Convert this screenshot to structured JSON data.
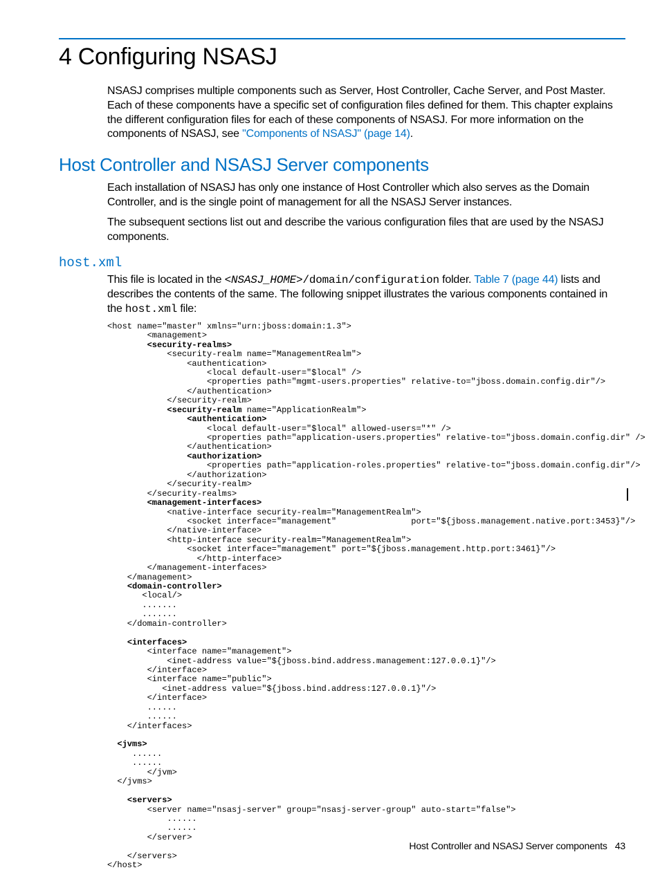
{
  "chapter": {
    "title": "4 Configuring NSASJ"
  },
  "intro": {
    "text_a": "NSASJ comprises multiple components such as Server, Host Controller, Cache Server, and Post Master. Each of these components have a specific set of configuration files defined for them. This chapter explains the different configuration files for each of these components of NSASJ. For more information on the components of NSASJ, see ",
    "link": "\"Components of NSASJ\" (page 14)",
    "text_b": "."
  },
  "section": {
    "title": "Host Controller and NSASJ Server components",
    "p1": "Each installation of NSASJ has only one instance of Host Controller which also serves as the Domain Controller, and is the single point of management for all the NSASJ Server instances.",
    "p2": "The subsequent sections list out and describe the various configuration files that are used by the NSASJ components."
  },
  "file": {
    "heading": "host.xml",
    "desc_pre": "This file is located in the ",
    "desc_path_em": "<NSASJ_HOME>",
    "desc_path_rest": "/domain/configuration",
    "desc_after_path": " folder. ",
    "desc_link": "Table 7 (page 44)",
    "desc_post_link": " lists and describes the contents of the same. The following snippet illustrates the various components contained in the ",
    "desc_filename": "host.xml",
    "desc_end": " file:"
  },
  "code": "<host name=\"master\" xmlns=\"urn:jboss:domain:1.3\">\n        <management>\n        <b><security-realms></b>\n            <security-realm name=\"ManagementRealm\">\n                <authentication>\n                    <local default-user=\"$local\" />\n                    <properties path=\"mgmt-users.properties\" relative-to=\"jboss.domain.config.dir\"/>\n                </authentication>\n            </security-realm>\n            <b><security-realm</b> name=\"ApplicationRealm\">\n                <b><authentication></b>\n                    <local default-user=\"$local\" allowed-users=\"*\" />\n                    <properties path=\"application-users.properties\" relative-to=\"jboss.domain.config.dir\" />\n                </authentication>\n                <b><authorization></b>\n                    <properties path=\"application-roles.properties\" relative-to=\"jboss.domain.config.dir\"/>\n                </authorization>\n            </security-realm>\n        </security-realms>\n        <b><management-interfaces></b>\n            <native-interface security-realm=\"ManagementRealm\">\n                <socket interface=\"management\"               port=\"${jboss.management.native.port:3453}\"/>\n            </native-interface>\n            <http-interface security-realm=\"ManagementRealm\">\n                <socket interface=\"management\" port=\"${jboss.management.http.port:3461}\"/>\n                  </http-interface>\n        </management-interfaces>\n    </management>\n    <b><domain-controller></b>\n       <local/>\n       .......\n       .......\n    </domain-controller>\n\n    <b><interfaces></b>\n        <interface name=\"management\">\n            <inet-address value=\"${jboss.bind.address.management:127.0.0.1}\"/>\n        </interface>\n        <interface name=\"public\">\n           <inet-address value=\"${jboss.bind.address:127.0.0.1}\"/>\n        </interface>\n        ......\n        ......\n    </interfaces>\n\n  <b><jvms></b>\n     ......\n     ......\n        </jvm>\n  </jvms>\n\n    <b><servers></b>\n        <server name=\"nsasj-server\" group=\"nsasj-server-group\" auto-start=\"false\">\n            ......\n            ......\n        </server>\n\n    </servers>\n</host>",
  "footer": {
    "text": "Host Controller and NSASJ Server components",
    "page": "43"
  }
}
